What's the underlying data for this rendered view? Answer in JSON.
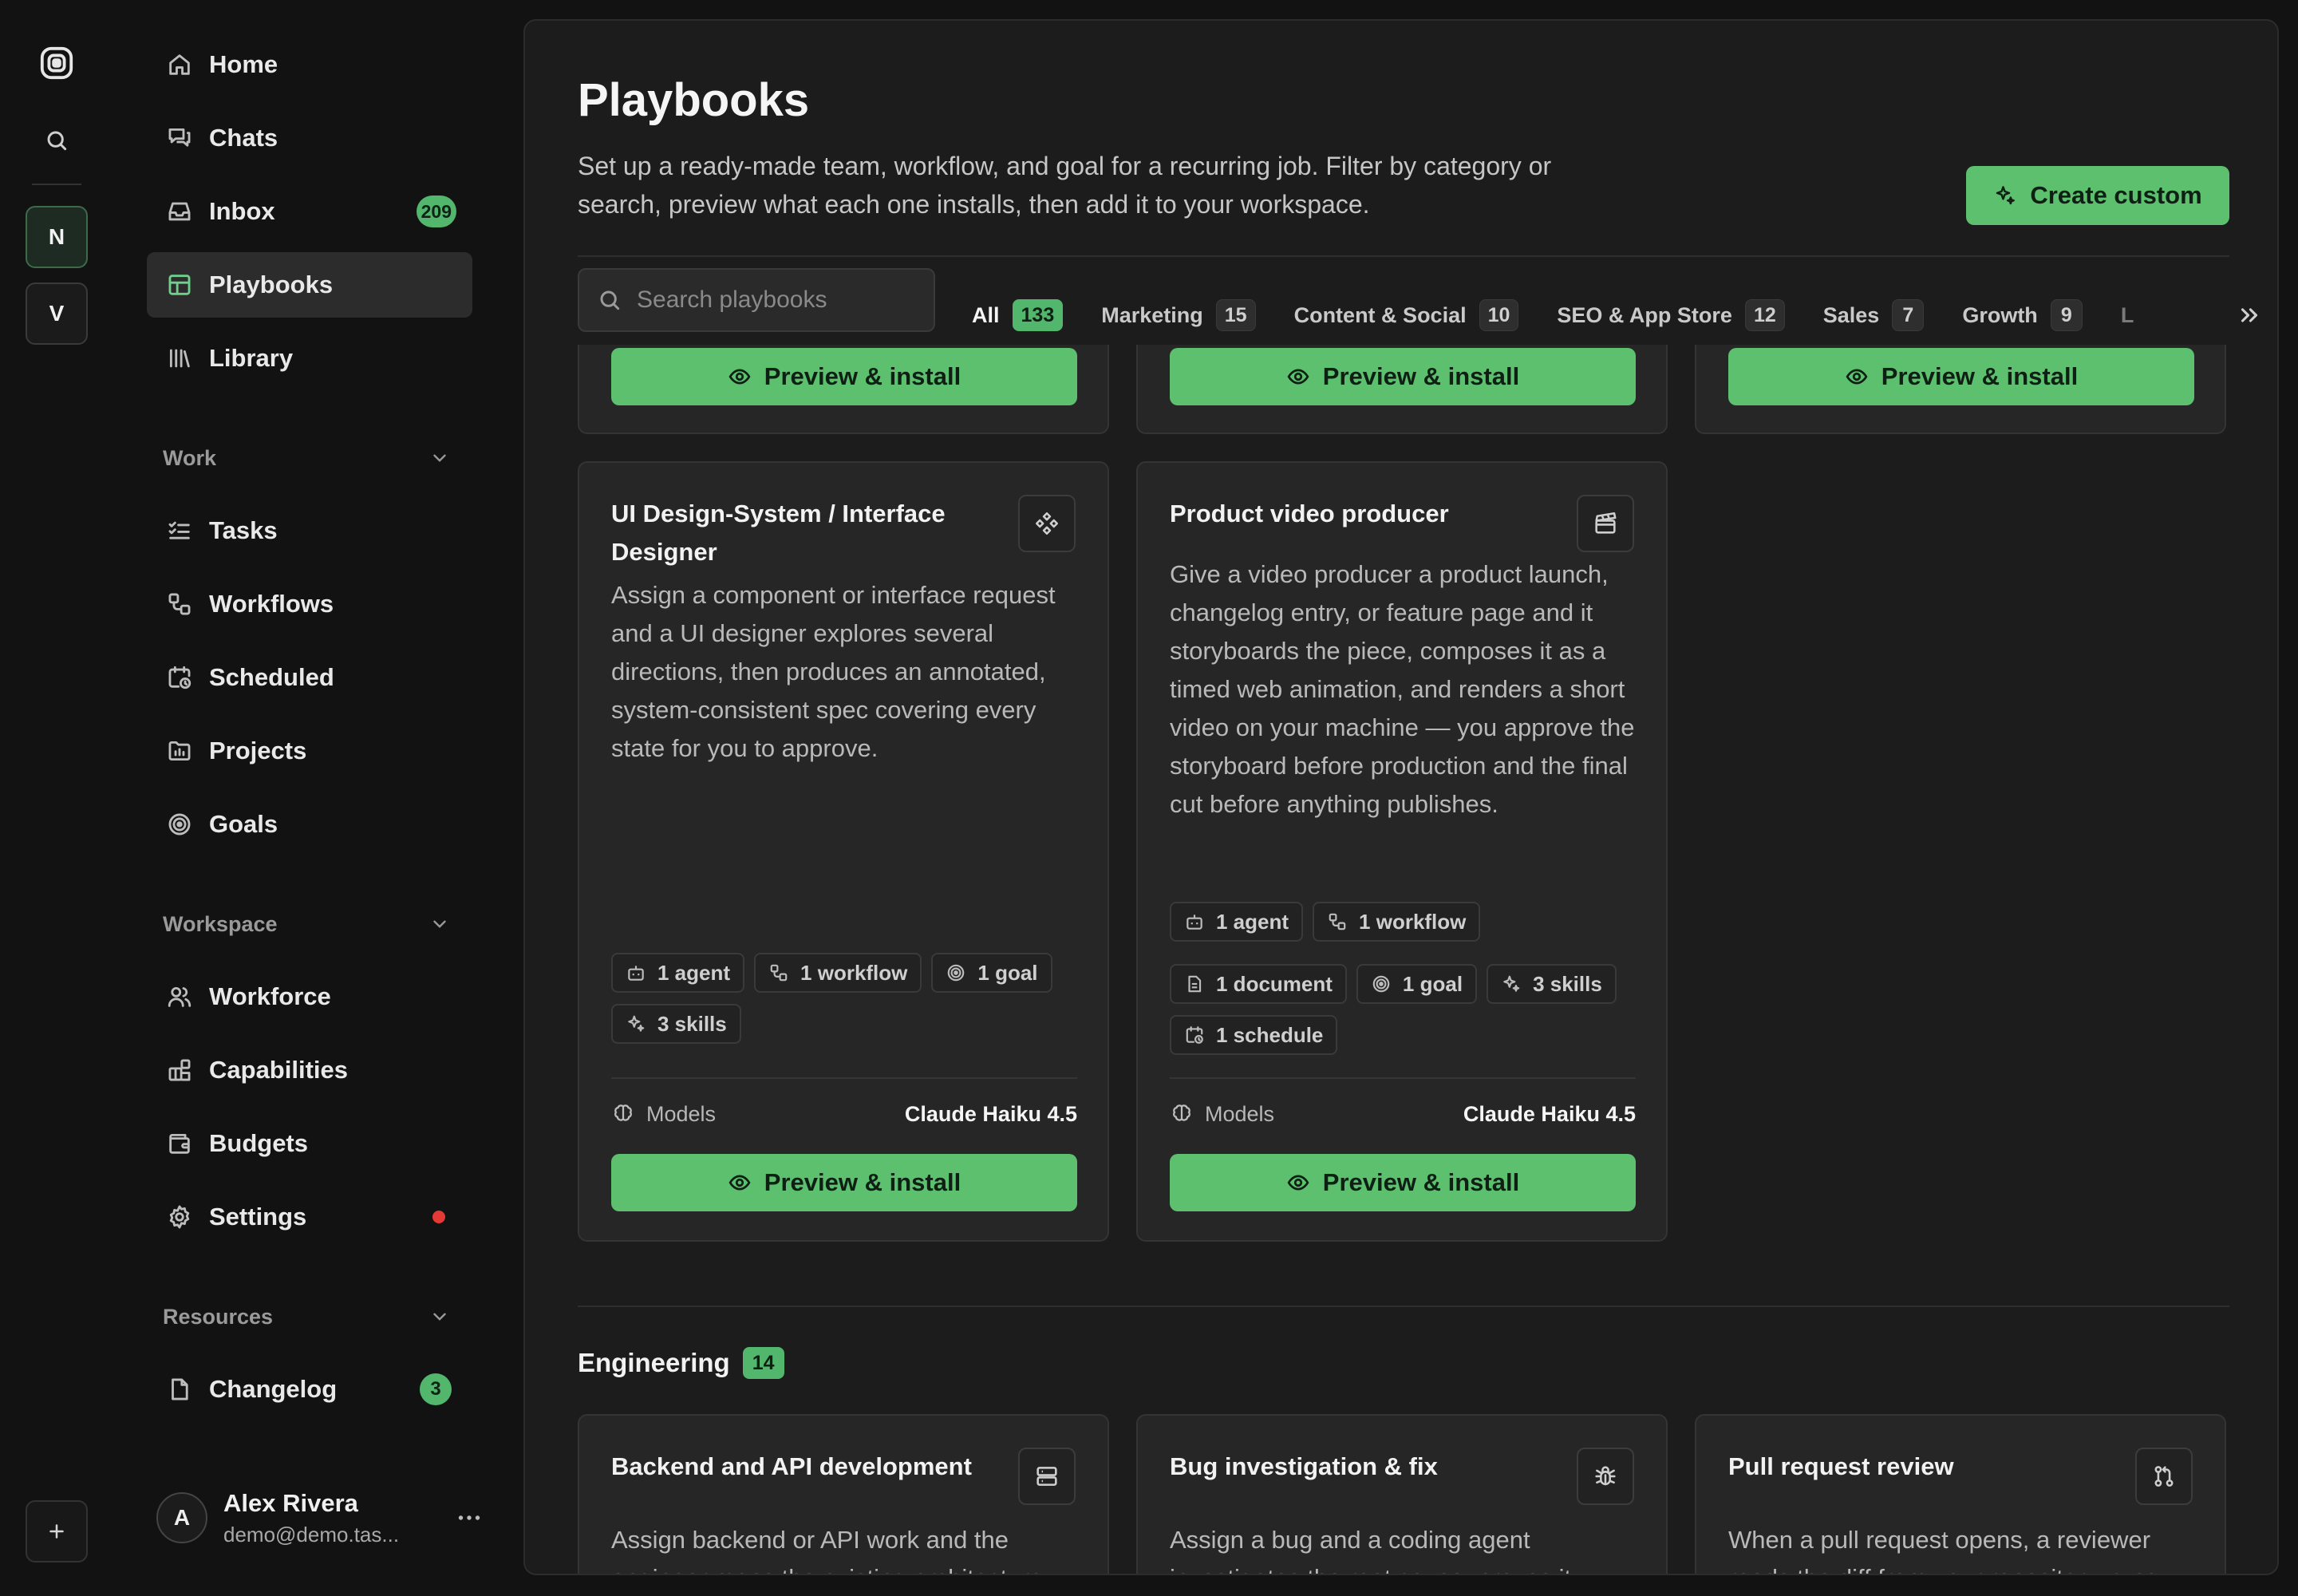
{
  "rail": {
    "workspaces": [
      {
        "initial": "N",
        "active": true
      },
      {
        "initial": "V",
        "active": false
      }
    ],
    "icons": {
      "logo": "app-logo-icon",
      "search": "search-icon",
      "add": "plus-icon"
    }
  },
  "sidebar": {
    "primary": [
      {
        "label": "Home",
        "icon": "home-icon"
      },
      {
        "label": "Chats",
        "icon": "chat-icon"
      },
      {
        "label": "Inbox",
        "icon": "inbox-icon",
        "badge": "209"
      },
      {
        "label": "Playbooks",
        "icon": "playbooks-icon",
        "active": true
      },
      {
        "label": "Library",
        "icon": "library-icon"
      }
    ],
    "work": {
      "header": "Work",
      "items": [
        {
          "label": "Tasks",
          "icon": "tasks-icon"
        },
        {
          "label": "Workflows",
          "icon": "workflow-icon"
        },
        {
          "label": "Scheduled",
          "icon": "calendar-clock-icon"
        },
        {
          "label": "Projects",
          "icon": "projects-icon"
        },
        {
          "label": "Goals",
          "icon": "target-icon"
        }
      ]
    },
    "workspace": {
      "header": "Workspace",
      "items": [
        {
          "label": "Workforce",
          "icon": "users-icon"
        },
        {
          "label": "Capabilities",
          "icon": "blocks-icon"
        },
        {
          "label": "Budgets",
          "icon": "wallet-icon"
        },
        {
          "label": "Settings",
          "icon": "gear-icon",
          "alert": true
        }
      ]
    },
    "resources": {
      "header": "Resources",
      "items": [
        {
          "label": "Changelog",
          "icon": "file-icon",
          "badge": "3"
        }
      ]
    },
    "user": {
      "initial": "A",
      "name": "Alex Rivera",
      "email": "demo@demo.tas..."
    }
  },
  "page": {
    "title": "Playbooks",
    "description": "Set up a ready-made team, workflow, and goal for a recurring job. Filter by category or search, preview what each one installs, then add it to your workspace.",
    "create_label": "Create custom"
  },
  "search": {
    "placeholder": "Search playbooks"
  },
  "tabs": [
    {
      "label": "All",
      "count": "133",
      "active": true
    },
    {
      "label": "Marketing",
      "count": "15"
    },
    {
      "label": "Content & Social",
      "count": "10"
    },
    {
      "label": "SEO & App Store",
      "count": "12"
    },
    {
      "label": "Sales",
      "count": "7"
    },
    {
      "label": "Growth",
      "count": "9"
    },
    {
      "label": "L",
      "count": ""
    }
  ],
  "install_label": "Preview & install",
  "models_label": "Models",
  "cards": [
    {
      "title": "UI Design-System / Interface Designer",
      "icon": "component-icon",
      "description": "Assign a component or interface request and a UI designer explores several directions, then produces an annotated, system-consistent spec covering every state for you to approve.",
      "chips": [
        {
          "icon": "bot-icon",
          "label": "1 agent"
        },
        {
          "icon": "workflow-icon",
          "label": "1 workflow"
        },
        {
          "icon": "target-icon",
          "label": "1 goal"
        },
        {
          "icon": "sparkles-icon",
          "label": "3 skills"
        }
      ],
      "model": "Claude Haiku 4.5"
    },
    {
      "title": "Product video producer",
      "icon": "clapperboard-icon",
      "description": "Give a video producer a product launch, changelog entry, or feature page and it storyboards the piece, composes it as a timed web animation, and renders a short video on your machine — you approve the storyboard before production and the final cut before anything publishes.",
      "chips": [
        {
          "icon": "bot-icon",
          "label": "1 agent"
        },
        {
          "icon": "workflow-icon",
          "label": "1 workflow"
        },
        {
          "icon": "document-icon",
          "label": "1 document"
        },
        {
          "icon": "target-icon",
          "label": "1 goal"
        },
        {
          "icon": "sparkles-icon",
          "label": "3 skills"
        },
        {
          "icon": "calendar-clock-icon",
          "label": "1 schedule"
        }
      ],
      "model": "Claude Haiku 4.5"
    }
  ],
  "engineering": {
    "title": "Engineering",
    "count": "14",
    "cards": [
      {
        "title": "Backend and API development",
        "icon": "server-icon",
        "description": "Assign backend or API work and the engineer maps the existing architecture,"
      },
      {
        "title": "Bug investigation & fix",
        "icon": "bug-icon",
        "description": "Assign a bug and a coding agent investigates the root cause, proves it"
      },
      {
        "title": "Pull request review",
        "icon": "git-pull-request-icon",
        "description": "When a pull request opens, a reviewer reads the diff from your repository, runs"
      }
    ]
  },
  "colors": {
    "accent": "#5cc06f",
    "alert": "#e53935",
    "background": "#121212",
    "panel": "#1c1c1c",
    "card": "#262626"
  }
}
